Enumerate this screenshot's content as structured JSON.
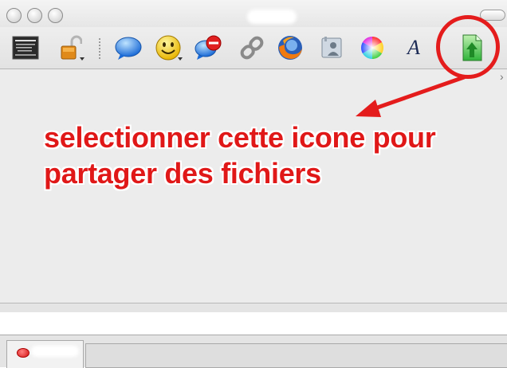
{
  "window": {
    "title": "",
    "traffic_lights": [
      "close",
      "minimize",
      "zoom"
    ]
  },
  "toolbar": {
    "items": [
      {
        "name": "user-picture-button",
        "icon": "buddy-image-icon"
      },
      {
        "name": "lock-button",
        "icon": "open-padlock-icon"
      },
      {
        "name": "chat-button",
        "icon": "blue-speech-bubble-icon"
      },
      {
        "name": "smiley-button",
        "icon": "smiley-face-icon"
      },
      {
        "name": "block-button",
        "icon": "blocked-chat-icon"
      },
      {
        "name": "link-button",
        "icon": "chain-link-icon"
      },
      {
        "name": "firefox-button",
        "icon": "firefox-icon"
      },
      {
        "name": "contact-card-button",
        "icon": "contact-card-icon"
      },
      {
        "name": "color-button",
        "icon": "color-wheel-icon"
      },
      {
        "name": "font-button",
        "icon": "font-letter-icon",
        "glyph": "A"
      },
      {
        "name": "send-file-button",
        "icon": "green-file-transfer-icon"
      }
    ]
  },
  "annotation": {
    "line1": "selectionner cette icone pour",
    "line2": "partager des fichiers",
    "color": "#e01818"
  },
  "tab_bar": {
    "tab_label": "",
    "status_color": "#d41212"
  },
  "colors": {
    "highlight": "#e41c1c",
    "window_bg": "#ececec",
    "file_icon_green": "#2fb33a"
  }
}
